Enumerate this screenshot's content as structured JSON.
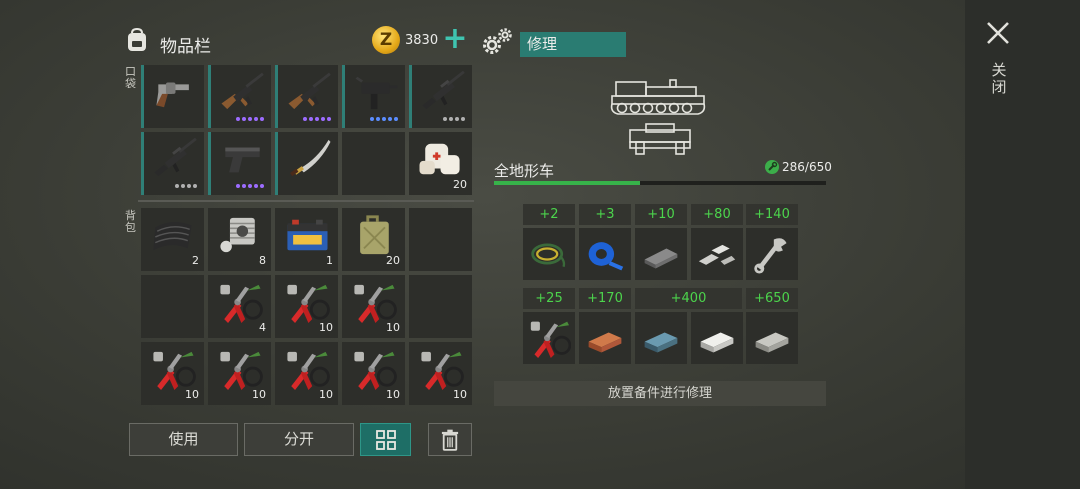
{
  "inventory": {
    "title": "物品栏",
    "coins": "3830",
    "pocket_label": "口袋",
    "backpack_label": "背包",
    "pocket_slots": [
      {
        "icon": "revolver-icon",
        "dots": [],
        "qty": ""
      },
      {
        "icon": "ak-rifle-icon",
        "dots": [
          "#9c6cff",
          "#9c6cff",
          "#9c6cff",
          "#9c6cff",
          "#9c6cff"
        ],
        "qty": ""
      },
      {
        "icon": "ak-rifle-icon",
        "dots": [
          "#9c6cff",
          "#9c6cff",
          "#9c6cff",
          "#9c6cff",
          "#9c6cff"
        ],
        "qty": ""
      },
      {
        "icon": "uzi-icon",
        "dots": [
          "#5b8dff",
          "#5b8dff",
          "#5b8dff",
          "#5b8dff",
          "#5b8dff"
        ],
        "qty": ""
      },
      {
        "icon": "m16-rifle-icon",
        "dots": [
          "#b0b0b0",
          "#b0b0b0",
          "#b0b0b0",
          "#b0b0b0"
        ],
        "qty": ""
      },
      {
        "icon": "m16-rifle-icon",
        "dots": [
          "#b0b0b0",
          "#b0b0b0",
          "#b0b0b0",
          "#b0b0b0"
        ],
        "qty": ""
      },
      {
        "icon": "pistol-icon",
        "dots": [
          "#9c6cff",
          "#9c6cff",
          "#9c6cff",
          "#9c6cff",
          "#9c6cff"
        ],
        "qty": ""
      },
      {
        "icon": "sword-icon",
        "dots": [],
        "qty": ""
      },
      {
        "icon": "empty",
        "dots": [],
        "qty": ""
      },
      {
        "icon": "bandage-icon",
        "dots": [],
        "qty": "20"
      }
    ],
    "backpack_slots": [
      {
        "icon": "rubber-sheet-icon",
        "qty": "2"
      },
      {
        "icon": "engine-cylinder-icon",
        "qty": "8"
      },
      {
        "icon": "car-battery-icon",
        "qty": "1"
      },
      {
        "icon": "jerrycan-icon",
        "qty": "20"
      },
      {
        "icon": "empty",
        "qty": ""
      },
      {
        "icon": "empty",
        "qty": ""
      },
      {
        "icon": "repair-tools-icon",
        "qty": "4"
      },
      {
        "icon": "repair-tools-icon",
        "qty": "10"
      },
      {
        "icon": "repair-tools-icon",
        "qty": "10"
      },
      {
        "icon": "empty",
        "qty": ""
      },
      {
        "icon": "repair-tools-icon",
        "qty": "10"
      },
      {
        "icon": "repair-tools-icon",
        "qty": "10"
      },
      {
        "icon": "repair-tools-icon",
        "qty": "10"
      },
      {
        "icon": "repair-tools-icon",
        "qty": "10"
      },
      {
        "icon": "repair-tools-icon",
        "qty": "10"
      }
    ],
    "buttons": {
      "use": "使用",
      "split": "分开"
    }
  },
  "repair": {
    "tab": "修理",
    "vehicle_name": "全地形车",
    "durability": "286/650",
    "durability_fraction": 0.44,
    "bonuses_row1": [
      "+2",
      "+3",
      "+10",
      "+80",
      "+140"
    ],
    "items_row1": [
      "wire-coil-icon",
      "blue-tape-icon",
      "metal-bar-icon",
      "metal-scraps-icon",
      "wrench-icon"
    ],
    "bonuses_row2": [
      "+25",
      "+170",
      "+400",
      "+650"
    ],
    "items_row2": [
      "repair-tools-icon",
      "copper-ingot-icon",
      "steel-ingot-icon",
      "silver-ingot-icon",
      "aluminum-ingot-icon"
    ],
    "hint": "放置备件进行修理"
  },
  "close_label": "关闭",
  "colors": {
    "accent": "#2a7c72",
    "bonus_green": "#4cd44c",
    "bar_green": "#37b34a"
  }
}
